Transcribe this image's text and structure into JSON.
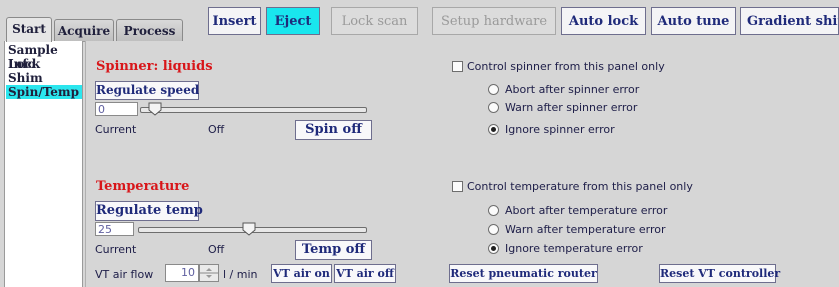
{
  "tabs": [
    {
      "label": "Start",
      "active": true
    },
    {
      "label": "Acquire",
      "active": false
    },
    {
      "label": "Process",
      "active": false
    }
  ],
  "toolbar": {
    "insert": "Insert",
    "eject": "Eject",
    "lock_scan": "Lock scan",
    "setup_hardware": "Setup hardware",
    "auto_lock": "Auto lock",
    "auto_tune": "Auto tune",
    "gradient_shim": "Gradient shim"
  },
  "nav": {
    "items": [
      {
        "label": "Sample Info",
        "selected": false
      },
      {
        "label": "Lock",
        "selected": false
      },
      {
        "label": "Shim",
        "selected": false
      },
      {
        "label": "Spin/Temp",
        "selected": true
      }
    ]
  },
  "spinner": {
    "title": "Spinner: liquids",
    "regulate_button": "Regulate speed",
    "value": "0",
    "current_label": "Current",
    "current_value": "Off",
    "off_button": "Spin off",
    "slider_fraction": 0.04,
    "control_checkbox": "Control spinner from this panel only",
    "options": [
      {
        "label": "Abort after spinner error",
        "selected": false
      },
      {
        "label": "Warn after spinner error",
        "selected": false
      },
      {
        "label": "Ignore spinner error",
        "selected": true
      }
    ]
  },
  "temperature": {
    "title": "Temperature",
    "regulate_button": "Regulate temp",
    "value": "25",
    "current_label": "Current",
    "current_value": "Off",
    "off_button": "Temp off",
    "slider_fraction": 0.49,
    "control_checkbox": "Control temperature from this panel only",
    "options": [
      {
        "label": "Abort after temperature error",
        "selected": false
      },
      {
        "label": "Warn after temperature error",
        "selected": false
      },
      {
        "label": "Ignore temperature error",
        "selected": true
      }
    ]
  },
  "vt": {
    "air_flow_label": "VT air flow",
    "air_flow_value": "10",
    "unit": "l / min",
    "air_on": "VT air on",
    "air_off": "VT air off"
  },
  "reset": {
    "pneumatic": "Reset pneumatic router",
    "vt_controller": "Reset VT controller"
  }
}
